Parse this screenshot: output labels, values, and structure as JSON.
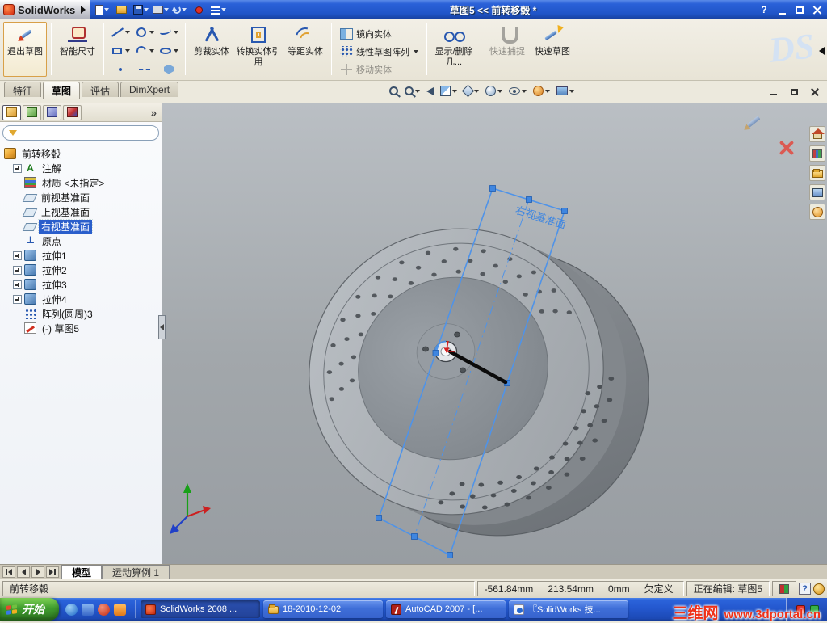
{
  "titlebar": {
    "brand": "SolidWorks",
    "title": "草图5 << 前转移毂 *",
    "help": "?"
  },
  "command_bar": {
    "exit_sketch": "退出草图",
    "smart_dimension": "智能尺寸",
    "trim": "剪裁实体",
    "convert": "转换实体引用",
    "offset": "等距实体",
    "mirror": "镜向实体",
    "linear_pattern": "线性草图阵列",
    "move": "移动实体",
    "display_delete": "显示/删除几...",
    "quick_snap": "快速捕捉",
    "rapid_sketch": "快速草图",
    "brand_watermark": "DS"
  },
  "ribbon_tabs": [
    {
      "label": "特征"
    },
    {
      "label": "草图"
    },
    {
      "label": "评估"
    },
    {
      "label": "DimXpert"
    }
  ],
  "glyphs": {
    "annotation": "A",
    "origin": "⊥",
    "chevron": "»",
    "help": "?"
  },
  "feature_tree": {
    "root": "前转移毂",
    "items": [
      {
        "label": "注解"
      },
      {
        "label": "材质 <未指定>"
      },
      {
        "label": "前视基准面"
      },
      {
        "label": "上视基准面"
      },
      {
        "label": "右视基准面"
      },
      {
        "label": "原点"
      },
      {
        "label": "拉伸1"
      },
      {
        "label": "拉伸2"
      },
      {
        "label": "拉伸3"
      },
      {
        "label": "拉伸4"
      },
      {
        "label": "阵列(圆周)3"
      },
      {
        "label": "(-) 草图5"
      }
    ]
  },
  "viewport": {
    "plane_label": "右视基准面"
  },
  "bottom_tabs": {
    "model": "模型",
    "motion": "运动算例 1"
  },
  "status_bar": {
    "part_name": "前转移毂",
    "x": "-561.84mm",
    "y": "213.54mm",
    "z": "0mm",
    "state": "欠定义",
    "editing": "正在编辑: 草图5"
  },
  "taskbar": {
    "start": "开始",
    "items": [
      {
        "label": "SolidWorks 2008 ..."
      },
      {
        "label": "18-2010-12-02"
      },
      {
        "label": "AutoCAD 2007 - [..."
      },
      {
        "label": "『SolidWorks 技..."
      }
    ],
    "watermark_site": "三维网",
    "watermark_url": "www.3dportal.cn"
  }
}
